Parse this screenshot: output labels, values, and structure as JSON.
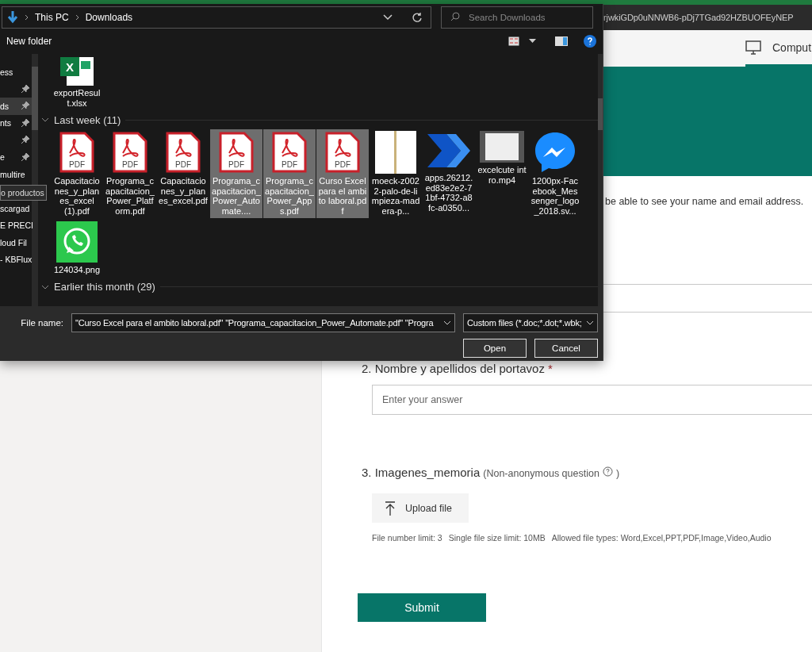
{
  "browser": {
    "url": "rjwkiGDp0uNNWB6-pDj7TGad92HZBUOFEyNEP",
    "tabs": [
      {
        "label": "Comput",
        "selected": true
      }
    ]
  },
  "form": {
    "notice": "be able to see your name and email address.",
    "questions": [
      {
        "kind": "text",
        "number": "2.",
        "title": "Nombre y apellidos del portavoz",
        "required_mark": "*",
        "placeholder": "Enter your answer"
      },
      {
        "kind": "upload",
        "number": "3.",
        "title": "Imagenes_memoria",
        "note": "(Non-anonymous question",
        "note_end": ")",
        "button": "Upload file",
        "limits": [
          "File number limit: 3",
          "Single file size limit: 10MB",
          "Allowed file types: Word,Excel,PPT,PDF,Image,Video,Audio"
        ]
      }
    ],
    "submit": "Submit"
  },
  "dialog": {
    "breadcrumb": [
      "This PC",
      "Downloads"
    ],
    "search": {
      "placeholder": "Search Downloads"
    },
    "new_folder": "New folder",
    "sidebar": [
      {
        "kind": "folder",
        "label": "ess",
        "pinned": false,
        "selected": false
      },
      {
        "kind": "folder",
        "pinned": true,
        "selected": false
      },
      {
        "kind": "folder",
        "label": "ds",
        "pinned": true,
        "selected": true
      },
      {
        "kind": "folder",
        "label": "nts",
        "pinned": true,
        "selected": false
      },
      {
        "kind": "folder",
        "pinned": true,
        "selected": false
      },
      {
        "kind": "folder",
        "label": "e",
        "pinned": true,
        "selected": false
      },
      {
        "kind": "folder",
        "label": "multire",
        "pinned": false,
        "selected": false
      },
      {
        "kind": "covered",
        "tooltip": "o productos"
      },
      {
        "kind": "folder",
        "label": "scargad",
        "pinned": false,
        "selected": false
      },
      {
        "kind": "folder",
        "label": "E PRECI",
        "pinned": false,
        "selected": false
      },
      {
        "kind": "folder",
        "label": "loud Fil",
        "pinned": false,
        "selected": false
      },
      {
        "kind": "folder",
        "label": "- KBFlux",
        "pinned": false,
        "selected": false
      }
    ],
    "top_files": [
      {
        "kind": "excel",
        "badge": "X",
        "name": "exportResult.xlsx",
        "selected": false
      }
    ],
    "groups": [
      {
        "label": "Last week (11)",
        "expanded": true,
        "files": [
          {
            "kind": "pdf",
            "badge": "PDF",
            "name": "Capacitaciones_y_planes_excel (1).pdf",
            "selected": false
          },
          {
            "kind": "pdf",
            "badge": "PDF",
            "name": "Programa_capacitacion_Power_Platform.pdf",
            "selected": false
          },
          {
            "kind": "pdf",
            "badge": "PDF",
            "name": "Capacitaciones_y_planes_excel.pdf",
            "selected": false
          },
          {
            "kind": "pdf",
            "badge": "PDF",
            "name": "Programa_capacitacion_Power_Automate....",
            "selected": true
          },
          {
            "kind": "pdf",
            "badge": "PDF",
            "name": "Programa_capacitacion_Power_Apps.pdf",
            "selected": true
          },
          {
            "kind": "pdf",
            "badge": "PDF",
            "name": "Curso Excel para el ambito laboral.pdf",
            "selected": true
          },
          {
            "kind": "photo",
            "name": "moeck-z0022-palo-de-limpieza-madera-p...",
            "selected": false
          },
          {
            "kind": "flow",
            "name": "apps.26212.ed83e2e2-71bf-4732-a8fc-a0350...",
            "selected": false
          },
          {
            "kind": "video",
            "name": "excelcute intro.mp4",
            "selected": false
          },
          {
            "kind": "messenger",
            "name": "1200px-Facebook_Messenger_logo_2018.sv...",
            "selected": false
          },
          {
            "kind": "whatsapp",
            "name": "124034.png",
            "selected": false
          }
        ]
      },
      {
        "label": "Earlier this month (29)",
        "expanded": true
      }
    ],
    "file_name": {
      "label": "File name:",
      "value": "\"Curso Excel para el ambito laboral.pdf\" \"Programa_capacitacion_Power_Automate.pdf\" \"Progra"
    },
    "file_type": "Custom files (*.doc;*.dot;*.wbk;",
    "buttons": [
      "Open",
      "Cancel"
    ]
  }
}
